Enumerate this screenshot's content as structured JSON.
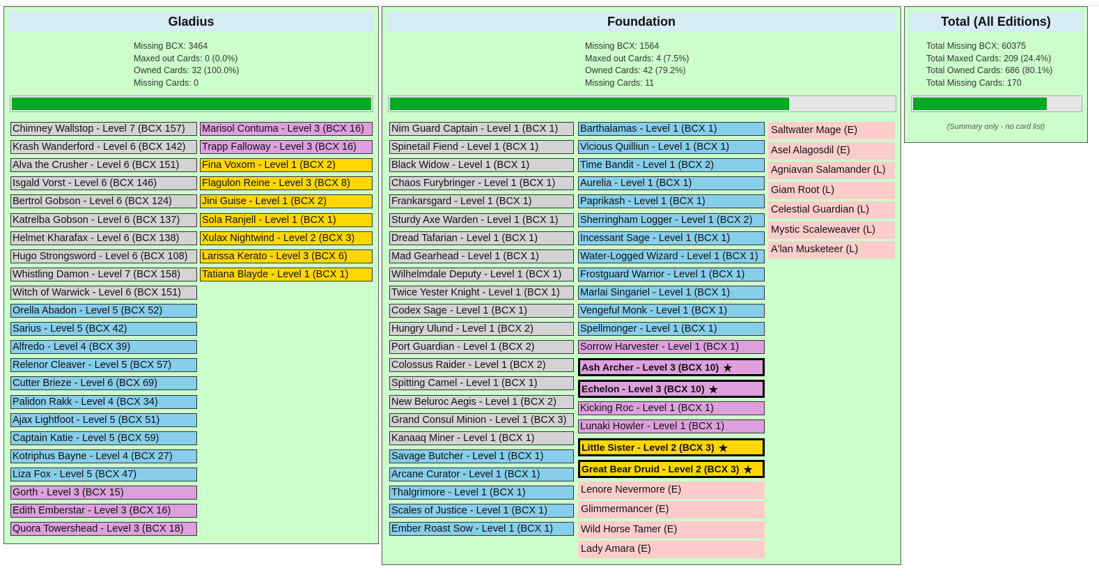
{
  "panels": {
    "gladius": {
      "title": "Gladius",
      "stats": [
        "Missing BCX: 3464",
        "Maxed out Cards: 0 (0.0%)",
        "Owned Cards: 32 (100.0%)",
        "Missing Cards: 0"
      ],
      "progress_fraction": 1.0,
      "columns": [
        [
          {
            "text": "Chimney Wallstop - Level 7 (BCX 157)",
            "color": "gray"
          },
          {
            "text": "Krash Wanderford - Level 6 (BCX 142)",
            "color": "gray"
          },
          {
            "text": "Alva the Crusher - Level 6 (BCX 151)",
            "color": "gray"
          },
          {
            "text": "Isgald Vorst - Level 6 (BCX 146)",
            "color": "gray"
          },
          {
            "text": "Bertrol Gobson - Level 6 (BCX 124)",
            "color": "gray"
          },
          {
            "text": "Katrelba Gobson - Level 6 (BCX 137)",
            "color": "gray"
          },
          {
            "text": "Helmet Kharafax - Level 6 (BCX 138)",
            "color": "gray"
          },
          {
            "text": "Hugo Strongsword - Level 6 (BCX 108)",
            "color": "gray"
          },
          {
            "text": "Whistling Damon - Level 7 (BCX 158)",
            "color": "gray"
          },
          {
            "text": "Witch of Warwick - Level 6 (BCX 151)",
            "color": "gray"
          },
          {
            "text": "Orella Abadon - Level 5 (BCX 52)",
            "color": "blue"
          },
          {
            "text": "Sarius - Level 5 (BCX 42)",
            "color": "blue"
          },
          {
            "text": "Alfredo - Level 4 (BCX 39)",
            "color": "blue"
          },
          {
            "text": "Relenor Cleaver - Level 5 (BCX 57)",
            "color": "blue"
          },
          {
            "text": "Cutter Brieze - Level 6 (BCX 69)",
            "color": "blue"
          },
          {
            "text": "Palidon Rakk - Level 4 (BCX 34)",
            "color": "blue"
          },
          {
            "text": "Ajax Lightfoot - Level 5 (BCX 51)",
            "color": "blue"
          },
          {
            "text": "Captain Katie - Level 5 (BCX 59)",
            "color": "blue"
          },
          {
            "text": "Kotriphus Bayne - Level 4 (BCX 27)",
            "color": "blue"
          },
          {
            "text": "Liza Fox - Level 5 (BCX 47)",
            "color": "blue"
          },
          {
            "text": "Gorth - Level 3 (BCX 15)",
            "color": "purple"
          },
          {
            "text": "Edith Emberstar - Level 3 (BCX 16)",
            "color": "purple"
          },
          {
            "text": "Quora Towershead - Level 3 (BCX 18)",
            "color": "purple"
          }
        ],
        [
          {
            "text": "Marisol Contuma - Level 3 (BCX 16)",
            "color": "purple"
          },
          {
            "text": "Trapp Falloway - Level 3 (BCX 16)",
            "color": "purple"
          },
          {
            "text": "Fina Voxom - Level 1 (BCX 2)",
            "color": "gold"
          },
          {
            "text": "Flagulon Reine - Level 3 (BCX 8)",
            "color": "gold"
          },
          {
            "text": "Jini Guise - Level 1 (BCX 2)",
            "color": "gold"
          },
          {
            "text": "Sola Ranjell - Level 1 (BCX 1)",
            "color": "gold"
          },
          {
            "text": "Xulax Nightwind - Level 2 (BCX 3)",
            "color": "gold"
          },
          {
            "text": "Larissa Kerato - Level 3 (BCX 6)",
            "color": "gold"
          },
          {
            "text": "Tatiana Blayde - Level 1 (BCX 1)",
            "color": "gold"
          }
        ]
      ]
    },
    "foundation": {
      "title": "Foundation",
      "stats": [
        "Missing BCX: 1564",
        "Maxed out Cards: 4 (7.5%)",
        "Owned Cards: 42 (79.2%)",
        "Missing Cards: 11"
      ],
      "progress_fraction": 0.792,
      "columns": [
        [
          {
            "text": "Nim Guard Captain - Level 1 (BCX 1)",
            "color": "gray"
          },
          {
            "text": "Spinetail Fiend - Level 1 (BCX 1)",
            "color": "gray"
          },
          {
            "text": "Black Widow - Level 1 (BCX 1)",
            "color": "gray"
          },
          {
            "text": "Chaos Furybringer - Level 1 (BCX 1)",
            "color": "gray"
          },
          {
            "text": "Frankarsgard - Level 1 (BCX 1)",
            "color": "gray"
          },
          {
            "text": "Sturdy Axe Warden - Level 1 (BCX 1)",
            "color": "gray"
          },
          {
            "text": "Dread Tafarian - Level 1 (BCX 1)",
            "color": "gray"
          },
          {
            "text": "Mad Gearhead - Level 1 (BCX 1)",
            "color": "gray"
          },
          {
            "text": "Wilhelmdale Deputy - Level 1 (BCX 1)",
            "color": "gray"
          },
          {
            "text": "Twice Yester Knight - Level 1 (BCX 1)",
            "color": "gray"
          },
          {
            "text": "Codex Sage - Level 1 (BCX 1)",
            "color": "gray"
          },
          {
            "text": "Hungry Ulund - Level 1 (BCX 2)",
            "color": "gray"
          },
          {
            "text": "Port Guardian - Level 1 (BCX 2)",
            "color": "gray"
          },
          {
            "text": "Colossus Raider - Level 1 (BCX 2)",
            "color": "gray"
          },
          {
            "text": "Spitting Camel - Level 1 (BCX 1)",
            "color": "gray"
          },
          {
            "text": "New Beluroc Aegis - Level 1 (BCX 2)",
            "color": "gray"
          },
          {
            "text": "Grand Consul Minion - Level 1 (BCX 3)",
            "color": "gray"
          },
          {
            "text": "Kanaaq Miner - Level 1 (BCX 1)",
            "color": "gray"
          },
          {
            "text": "Savage Butcher - Level 1 (BCX 1)",
            "color": "blue"
          },
          {
            "text": "Arcane Curator - Level 1 (BCX 1)",
            "color": "blue"
          },
          {
            "text": "Thalgrimore - Level 1 (BCX 1)",
            "color": "blue"
          },
          {
            "text": "Scales of Justice - Level 1 (BCX 1)",
            "color": "blue"
          },
          {
            "text": "Ember Roast Sow - Level 1 (BCX 1)",
            "color": "blue"
          }
        ],
        [
          {
            "text": "Barthalamas - Level 1 (BCX 1)",
            "color": "blue"
          },
          {
            "text": "Vicious Quilliun - Level 1 (BCX 1)",
            "color": "blue"
          },
          {
            "text": "Time Bandit - Level 1 (BCX 2)",
            "color": "blue"
          },
          {
            "text": "Aurelia - Level 1 (BCX 1)",
            "color": "blue"
          },
          {
            "text": "Paprikash - Level 1 (BCX 1)",
            "color": "blue"
          },
          {
            "text": "Sherringham Logger - Level 1 (BCX 2)",
            "color": "blue"
          },
          {
            "text": "Incessant Sage - Level 1 (BCX 1)",
            "color": "blue"
          },
          {
            "text": "Water-Logged Wizard - Level 1 (BCX 1)",
            "color": "blue"
          },
          {
            "text": "Frostguard Warrior - Level 1 (BCX 1)",
            "color": "blue"
          },
          {
            "text": "Marlai Singariel - Level 1 (BCX 1)",
            "color": "blue"
          },
          {
            "text": "Vengeful Monk - Level 1 (BCX 1)",
            "color": "blue"
          },
          {
            "text": "Spellmonger - Level 1 (BCX 1)",
            "color": "blue"
          },
          {
            "text": "Sorrow Harvester - Level 1 (BCX 1)",
            "color": "purple"
          },
          {
            "text": "Ash Archer - Level 3 (BCX 10)",
            "color": "purple",
            "maxed": true
          },
          {
            "text": "Echelon - Level 3 (BCX 10)",
            "color": "purple",
            "maxed": true
          },
          {
            "text": "Kicking Roc - Level 1 (BCX 1)",
            "color": "purple"
          },
          {
            "text": "Lunaki Howler - Level 1 (BCX 1)",
            "color": "purple"
          },
          {
            "text": "Little Sister - Level 2 (BCX 3)",
            "color": "gold",
            "maxed": true
          },
          {
            "text": "Great Bear Druid - Level 2 (BCX 3)",
            "color": "gold",
            "maxed": true
          },
          {
            "text": "Lenore Nevermore (E)",
            "color": "pink"
          },
          {
            "text": "Glimmermancer (E)",
            "color": "pink"
          },
          {
            "text": "Wild Horse Tamer (E)",
            "color": "pink"
          },
          {
            "text": "Lady Amara (E)",
            "color": "pink"
          }
        ],
        [
          {
            "text": "Saltwater Mage (E)",
            "color": "pink"
          },
          {
            "text": "Asel Alagosdil (E)",
            "color": "pink"
          },
          {
            "text": "Agniavan Salamander (L)",
            "color": "pink"
          },
          {
            "text": "Giam Root (L)",
            "color": "pink"
          },
          {
            "text": "Celestial Guardian (L)",
            "color": "pink"
          },
          {
            "text": "Mystic Scaleweaver (L)",
            "color": "pink"
          },
          {
            "text": "A'lan Musketeer (L)",
            "color": "pink"
          }
        ]
      ]
    },
    "total": {
      "title": "Total (All Editions)",
      "stats": [
        "Total Missing BCX: 60375",
        "Total Maxed Cards: 209 (24.4%)",
        "Total Owned Cards: 686 (80.1%)",
        "Total Missing Cards: 170"
      ],
      "progress_fraction": 0.801,
      "note": "(Summary only - no card list)"
    }
  },
  "colors": {
    "gray": "#d3d3d3",
    "blue": "#87ceeb",
    "purple": "#dda0dd",
    "gold": "#ffd700",
    "pink": "#ffcccc",
    "progress": "#00aa22",
    "panel_bg": "#ccffcc"
  },
  "icons": {
    "maxed": "star-icon"
  }
}
